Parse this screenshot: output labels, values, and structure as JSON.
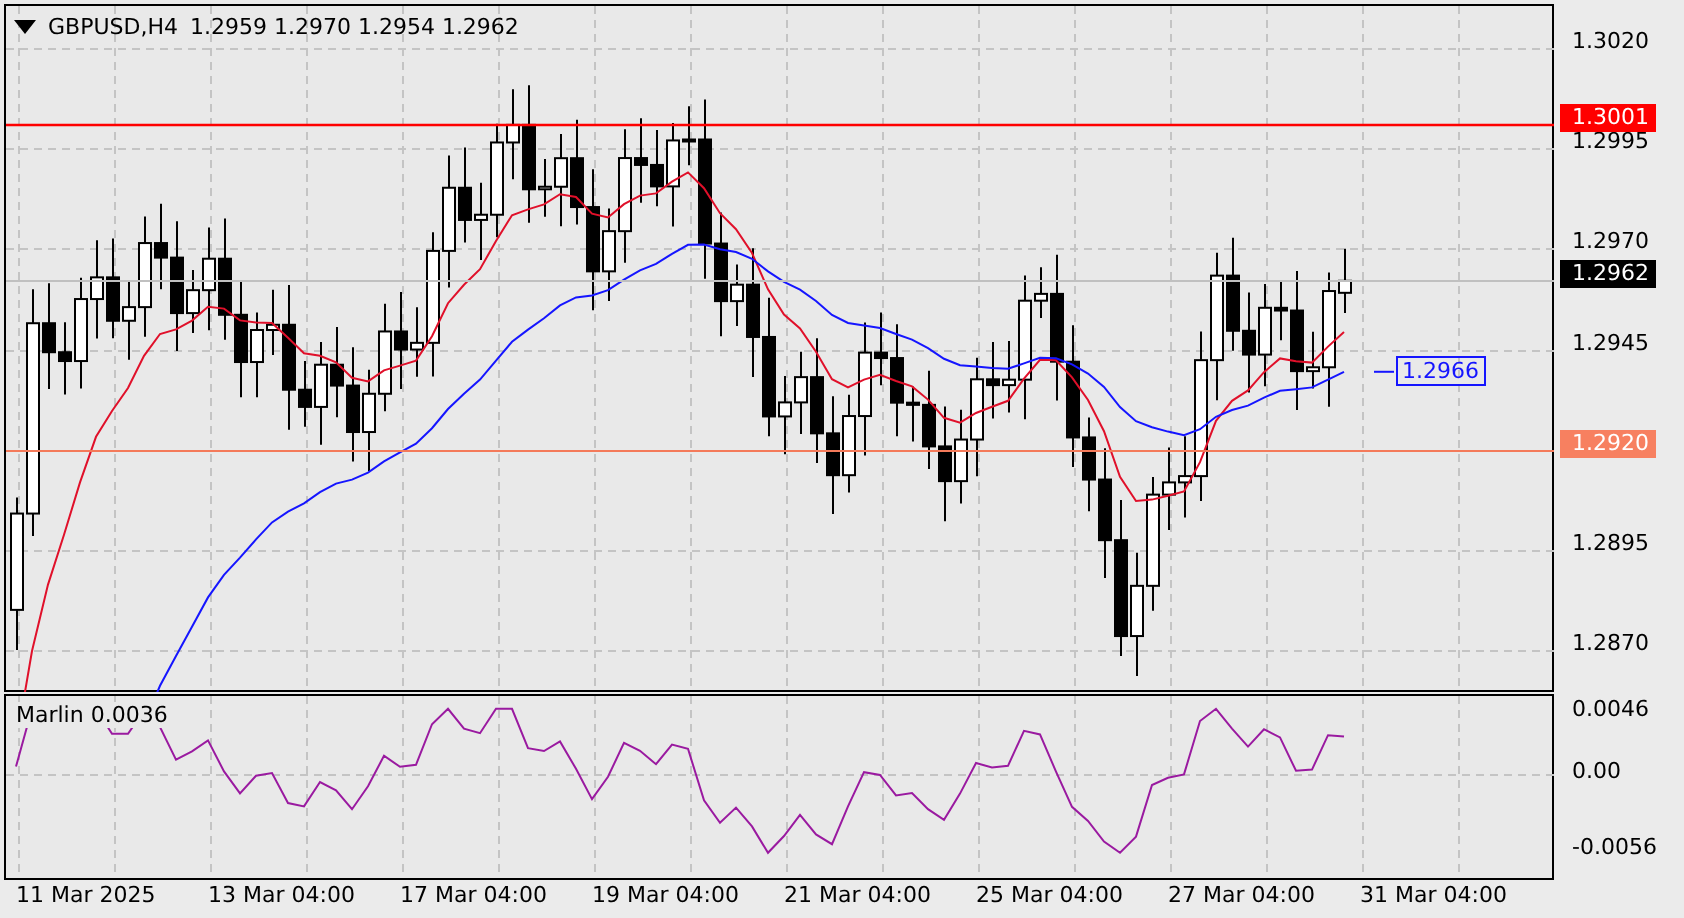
{
  "chart": {
    "symbol": "GBPUSD,H4",
    "ohlc": [
      "1.2959",
      "1.2970",
      "1.2954",
      "1.2962"
    ],
    "price_axis": [
      "1.3020",
      "1.2995",
      "1.2970",
      "1.2945",
      "1.2895",
      "1.2870"
    ],
    "levels": [
      {
        "label": "1.3001",
        "kind": "resistance"
      },
      {
        "label": "1.2962",
        "kind": "bid"
      },
      {
        "label": "1.2920",
        "kind": "support"
      }
    ],
    "ma_label": "1.2966"
  },
  "indicator": {
    "name": "Marlin 0.0036",
    "axis": [
      "0.0046",
      "0.00",
      "-0.0056"
    ]
  },
  "time_axis": [
    "11 Mar 2025",
    "13 Mar 04:00",
    "17 Mar 04:00",
    "19 Mar 04:00",
    "21 Mar 04:00",
    "25 Mar 04:00",
    "27 Mar 04:00",
    "31 Mar 04:00"
  ]
}
